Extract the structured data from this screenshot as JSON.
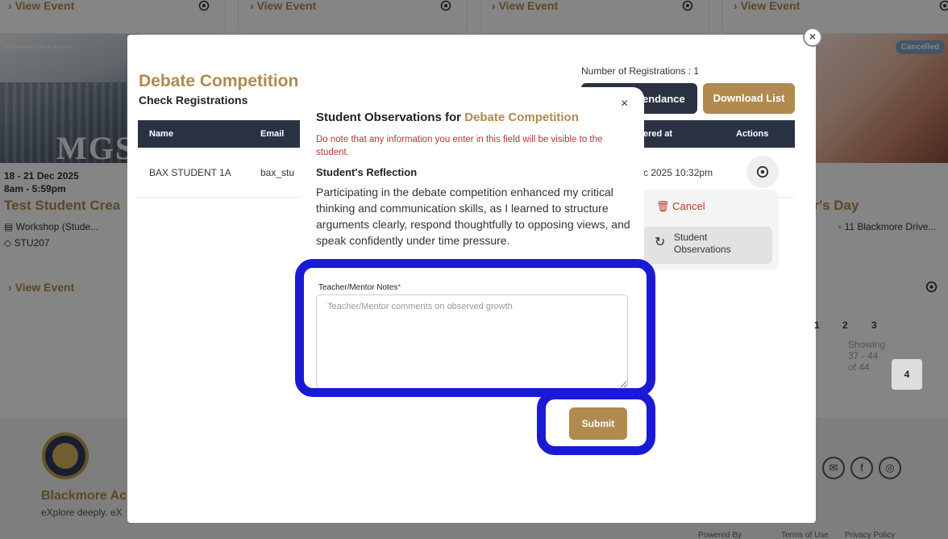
{
  "background": {
    "view_event_label": "View Event",
    "left_event": {
      "school_caption": "METHODIST GIRLS' SCHOOL",
      "image_text": "MGS",
      "date": "18 - 21 Dec 2025",
      "time": "8am - 5:59pm",
      "title": "Test Student Crea",
      "type": "Workshop (Stude...",
      "code": "STU207"
    },
    "right_event": {
      "badge": "Cancelled",
      "title": "er's Day",
      "location": "11 Blackmore Drive..."
    },
    "footer": {
      "brand": "Blackmore Ac",
      "tagline": "eXplore deeply. eX",
      "powered_by": "Powered By",
      "links": [
        "Terms of Use",
        "Privacy Policy"
      ]
    }
  },
  "registrations_modal": {
    "title": "Debate Competition",
    "subtitle": "Check Registrations",
    "count_text": "Number of Registrations : 1",
    "attendance_button": "endance",
    "download_button": "Download List",
    "columns": [
      "Name",
      "Email",
      "ered at",
      "Actions"
    ],
    "rows": [
      {
        "name": "BAX STUDENT 1A",
        "email": "bax_stu",
        "registered_at": "c 2025 10:32pm"
      }
    ],
    "actions_menu": {
      "cancel": "Cancel",
      "observations": [
        "Student",
        "Observations"
      ]
    },
    "pagination": {
      "showing": "Showing 37 - 44 of 44",
      "pages": [
        "1",
        "2",
        "3",
        "4"
      ],
      "current": "4"
    }
  },
  "observation_dialog": {
    "close": "×",
    "title_prefix": "Student Observations for ",
    "title_event": "Debate Competition",
    "notice": "Do note that any information you enter in this field will be visible to the student.",
    "reflection_heading": "Student's Reflection",
    "reflection_text": "Participating in the debate competition enhanced my critical thinking and communication skills, as I learned to structure arguments clearly, respond thoughtfully to opposing views, and speak confidently under time pressure.",
    "notes_label": "Teacher/Mentor Notes",
    "notes_required": "*",
    "notes_placeholder": "Teacher/Mentor comments on observed growth",
    "notes_value": "",
    "submit_label": "Submit"
  },
  "colors": {
    "accent_gold": "#b08a4e",
    "navy": "#2a3143",
    "highlight": "#1a1ad6",
    "warning_red": "#b03a3a"
  }
}
